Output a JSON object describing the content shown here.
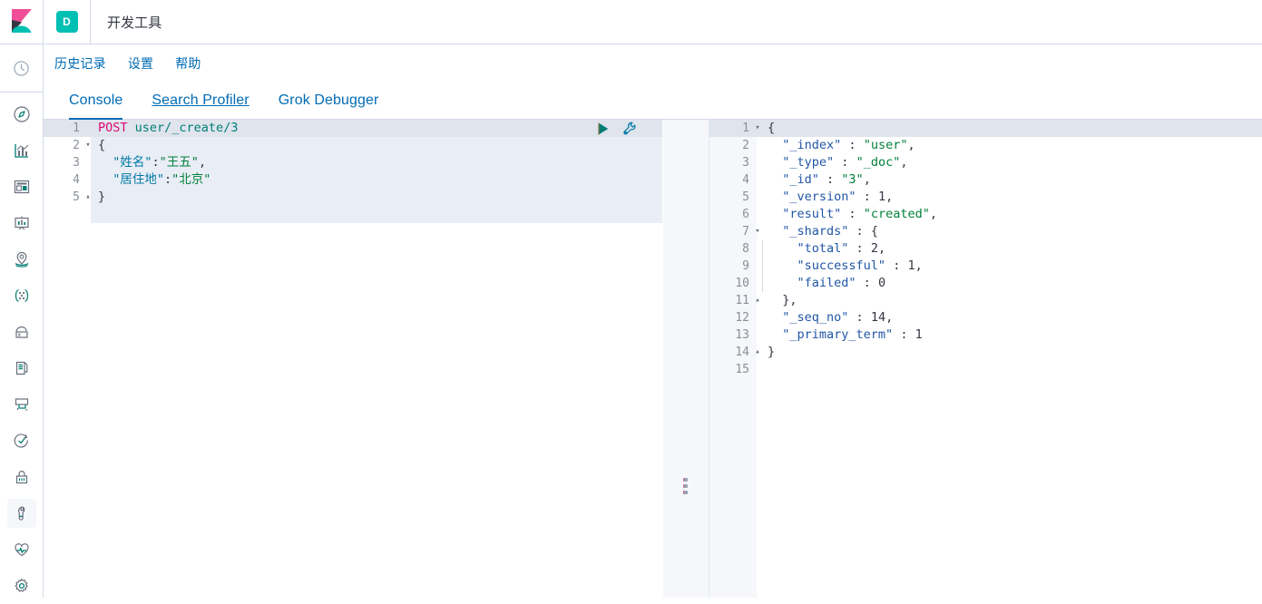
{
  "header": {
    "logo_name": "kibana-logo",
    "app_badge": "D",
    "app_title": "开发工具"
  },
  "side_rail": {
    "top_item": {
      "label": "recently-viewed",
      "icon": "clock-icon"
    },
    "items": [
      {
        "label": "discover",
        "icon": "compass-icon",
        "active": false
      },
      {
        "label": "visualize",
        "icon": "bar-chart-icon",
        "active": false
      },
      {
        "label": "dashboard",
        "icon": "dashboard-icon",
        "active": false
      },
      {
        "label": "canvas",
        "icon": "presentation-icon",
        "active": false
      },
      {
        "label": "maps",
        "icon": "map-marker-icon",
        "active": false
      },
      {
        "label": "machine-learning",
        "icon": "ml-icon",
        "active": false
      },
      {
        "label": "infrastructure",
        "icon": "infrastructure-icon",
        "active": false
      },
      {
        "label": "logs",
        "icon": "document-icon",
        "active": false
      },
      {
        "label": "apm",
        "icon": "apm-icon",
        "active": false
      },
      {
        "label": "uptime",
        "icon": "uptime-icon",
        "active": false
      },
      {
        "label": "siem",
        "icon": "lock-icon",
        "active": false
      },
      {
        "label": "dev-tools",
        "icon": "wrench-icon",
        "active": true
      },
      {
        "label": "monitoring",
        "icon": "heart-pulse-icon",
        "active": false
      },
      {
        "label": "management",
        "icon": "gear-icon",
        "active": false
      }
    ]
  },
  "console": {
    "menu": [
      {
        "label": "历史记录",
        "name": "history"
      },
      {
        "label": "设置",
        "name": "settings"
      },
      {
        "label": "帮助",
        "name": "help"
      }
    ],
    "tabs": [
      {
        "label": "Console",
        "name": "console",
        "active": true,
        "hovered": false
      },
      {
        "label": "Search Profiler",
        "name": "search-profiler",
        "active": false,
        "hovered": true
      },
      {
        "label": "Grok Debugger",
        "name": "grok-debugger",
        "active": false,
        "hovered": false
      }
    ],
    "actions": {
      "play_label": "send-request",
      "wrench_label": "request-options"
    }
  },
  "request": {
    "lines": [
      {
        "no": "1",
        "fold": "",
        "current": true
      },
      {
        "no": "2",
        "fold": "▾",
        "current": false
      },
      {
        "no": "3",
        "fold": "",
        "current": false
      },
      {
        "no": "4",
        "fold": "",
        "current": false
      },
      {
        "no": "5",
        "fold": "▴",
        "current": false
      }
    ],
    "method": "POST",
    "url": "user/_create/3",
    "open_brace": "{",
    "field1_key": "\"姓名\"",
    "field1_colon": ":",
    "field1_value": "\"王五\"",
    "field1_comma": ",",
    "field2_key": "\"居住地\"",
    "field2_colon": ":",
    "field2_value": "\"北京\"",
    "close_brace": "}"
  },
  "response": {
    "lines": [
      {
        "no": "1",
        "fold": "▾",
        "current": true
      },
      {
        "no": "2",
        "fold": "",
        "current": false
      },
      {
        "no": "3",
        "fold": "",
        "current": false
      },
      {
        "no": "4",
        "fold": "",
        "current": false
      },
      {
        "no": "5",
        "fold": "",
        "current": false
      },
      {
        "no": "6",
        "fold": "",
        "current": false
      },
      {
        "no": "7",
        "fold": "▾",
        "current": false
      },
      {
        "no": "8",
        "fold": "",
        "current": false
      },
      {
        "no": "9",
        "fold": "",
        "current": false
      },
      {
        "no": "10",
        "fold": "",
        "current": false
      },
      {
        "no": "11",
        "fold": "▴",
        "current": false
      },
      {
        "no": "12",
        "fold": "",
        "current": false
      },
      {
        "no": "13",
        "fold": "",
        "current": false
      },
      {
        "no": "14",
        "fold": "▴",
        "current": false
      },
      {
        "no": "15",
        "fold": "",
        "current": false
      }
    ],
    "l1": "{",
    "l2_key": "\"_index\"",
    "l2_sep": " : ",
    "l2_val": "\"user\"",
    "l2_end": ",",
    "l3_key": "\"_type\"",
    "l3_sep": " : ",
    "l3_val": "\"_doc\"",
    "l3_end": ",",
    "l4_key": "\"_id\"",
    "l4_sep": " : ",
    "l4_val": "\"3\"",
    "l4_end": ",",
    "l5_key": "\"_version\"",
    "l5_sep": " : ",
    "l5_val": "1",
    "l5_end": ",",
    "l6_key": "\"result\"",
    "l6_sep": " : ",
    "l6_val": "\"created\"",
    "l6_end": ",",
    "l7_key": "\"_shards\"",
    "l7_sep": " : ",
    "l7_val": "{",
    "l8_key": "\"total\"",
    "l8_sep": " : ",
    "l8_val": "2",
    "l8_end": ",",
    "l9_key": "\"successful\"",
    "l9_sep": " : ",
    "l9_val": "1",
    "l9_end": ",",
    "l10_key": "\"failed\"",
    "l10_sep": " : ",
    "l10_val": "0",
    "l11": "},",
    "l12_key": "\"_seq_no\"",
    "l12_sep": " : ",
    "l12_val": "14",
    "l12_end": ",",
    "l13_key": "\"_primary_term\"",
    "l13_sep": " : ",
    "l13_val": "1",
    "l14": "}",
    "l15": ""
  },
  "colors": {
    "accent": "#006bb4",
    "brand_teal": "#00bfb3",
    "method": "#dd0a73",
    "url": "#007e77",
    "key": "#0079a5",
    "string": "#00803b",
    "border": "#d3dae6",
    "editor_bg": "#f5f7fa",
    "current_line": "#dfe4ed"
  }
}
